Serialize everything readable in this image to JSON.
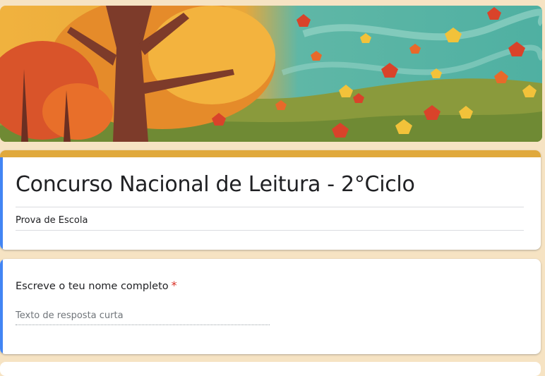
{
  "theme": {
    "background": "#f6e3c3",
    "accent_strip": "#e0a93c",
    "focus_bar": "#4285f4",
    "required_color": "#d93025"
  },
  "header": {
    "image": "autumn-trees-falling-leaves-illustration"
  },
  "form": {
    "title": "Concurso Nacional de Leitura - 2°Ciclo",
    "description": "Prova de Escola"
  },
  "questions": [
    {
      "label": "Escreve o teu nome completo",
      "required_mark": "*",
      "placeholder": "Texto de resposta curta"
    }
  ]
}
